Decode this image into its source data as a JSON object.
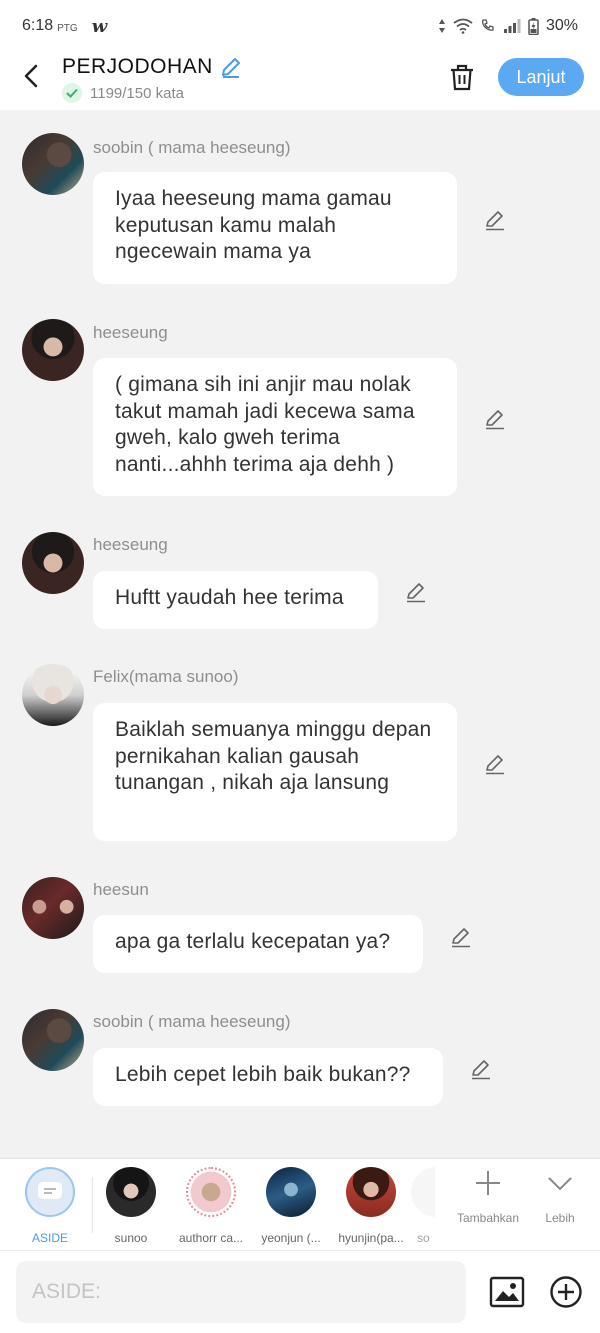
{
  "status": {
    "time": "6:18",
    "carrier": "PTG",
    "app_logo": "w",
    "battery": "30%"
  },
  "header": {
    "title": "PERJODOHAN",
    "word_count": "1199/150 kata",
    "next_label": "Lanjut"
  },
  "messages": [
    {
      "name": "soobin ( mama heeseung)",
      "text": "Iyaa heeseung mama gamau keputusan kamu malah ngecewain mama ya"
    },
    {
      "name": "heeseung",
      "text": "( gimana sih ini anjir mau nolak takut mamah jadi kecewa sama gweh, kalo gweh terima nanti...ahhh terima aja dehh )"
    },
    {
      "name": "heeseung",
      "text": "Huftt yaudah hee terima"
    },
    {
      "name": "Felix(mama sunoo)",
      "text": "Baiklah semuanya minggu depan pernikahan kalian gausah tunangan , nikah aja lansung"
    },
    {
      "name": "heesun",
      "text": "apa ga terlalu kecepatan ya?"
    },
    {
      "name": "soobin ( mama heeseung)",
      "text": "Lebih cepet lebih baik bukan??"
    }
  ],
  "characters": [
    {
      "label": "ASIDE"
    },
    {
      "label": "sunoo"
    },
    {
      "label": "authorr ca..."
    },
    {
      "label": "yeonjun (..."
    },
    {
      "label": "hyunjin(pa..."
    },
    {
      "label": "so"
    }
  ],
  "tools": {
    "add_label": "Tambahkan",
    "more_label": "Lebih"
  },
  "input": {
    "placeholder": "ASIDE:"
  },
  "colors": {
    "accent": "#5aa9f2",
    "background": "#f2f2f2",
    "bubble": "#ffffff",
    "name_text": "#8e8e8e"
  }
}
